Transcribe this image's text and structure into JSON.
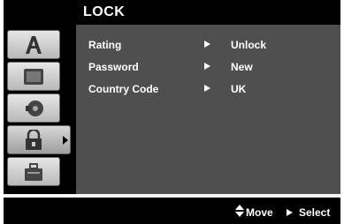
{
  "header": {
    "title": "LOCK"
  },
  "sidebar": {
    "tabs": [
      {
        "icon": "language-icon"
      },
      {
        "icon": "display-icon"
      },
      {
        "icon": "audio-icon"
      },
      {
        "icon": "lock-icon",
        "active": true
      },
      {
        "icon": "others-icon"
      }
    ]
  },
  "menu": {
    "rows": [
      {
        "label": "Rating",
        "value": "Unlock"
      },
      {
        "label": "Password",
        "value": "New"
      },
      {
        "label": "Country Code",
        "value": "UK"
      }
    ]
  },
  "footer": {
    "move_label": "Move",
    "select_label": "Select"
  },
  "colors": {
    "panel": "#4f4f4f",
    "bar": "#000000",
    "text": "#ffffff"
  }
}
